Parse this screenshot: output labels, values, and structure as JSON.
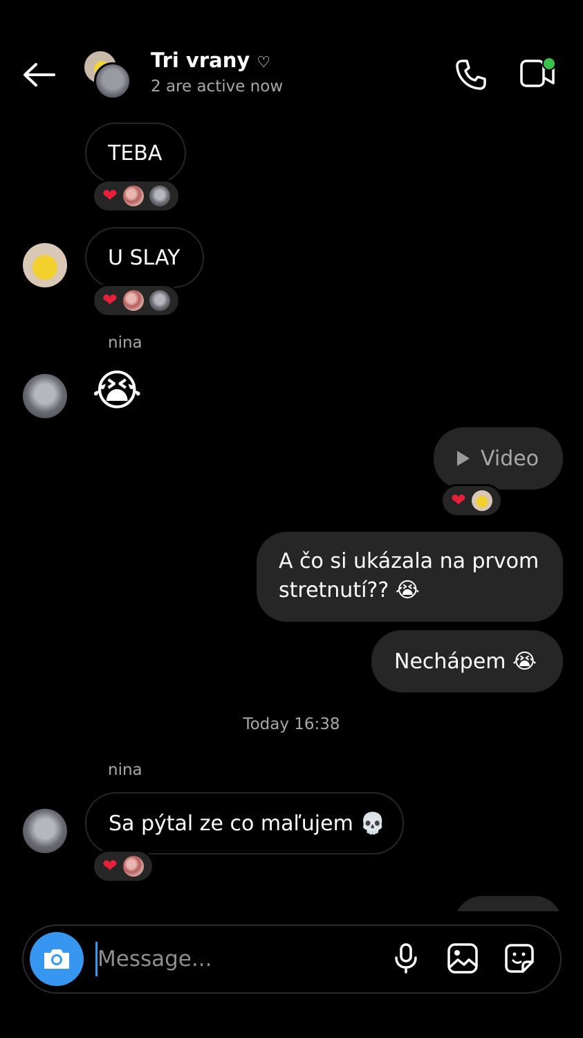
{
  "header": {
    "title": "Tri vrany",
    "title_suffix": "♡",
    "status": "2 are active now"
  },
  "messages": [
    {
      "text": "TEBA"
    },
    {
      "text": "U SLAY"
    },
    {
      "sender": "nina",
      "emoji": "😭"
    },
    {
      "text": "Video"
    },
    {
      "text_line1": "A čo si ukázala na prvom",
      "text_line2": "stretnutí?? 😭"
    },
    {
      "text": "Nechápem 😭"
    },
    {
      "sender": "nina",
      "text": "Sa pýtal ze co maľujem 💀"
    }
  ],
  "timestamp": "Today 16:38",
  "reactions": {
    "heart": "❤"
  },
  "composer": {
    "placeholder": "Message..."
  },
  "colors": {
    "accent": "#3797f0",
    "bubble_out": "#262626",
    "online": "#3ac24a",
    "heart": "#e8203a"
  }
}
